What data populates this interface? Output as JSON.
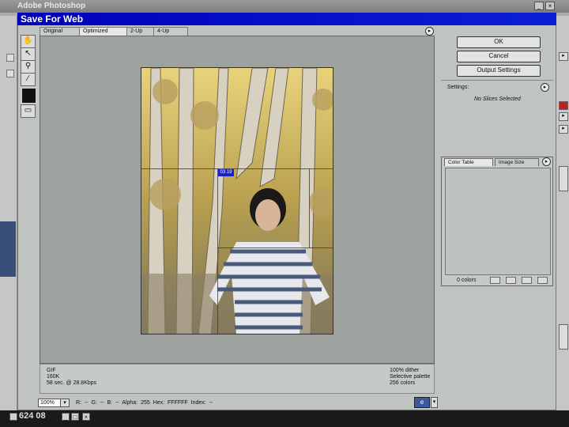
{
  "app": {
    "title": "Adobe Photoshop",
    "taskbar_title": "624 08"
  },
  "dialog": {
    "title": "Save For Web"
  },
  "tabs": [
    "Original",
    "Optimized",
    "2-Up",
    "4-Up"
  ],
  "tools": [
    "hand-tool",
    "slice-select-tool",
    "zoom-tool",
    "eyedropper-tool",
    "eyedropper-color",
    "toggle-slices-visibility"
  ],
  "preview": {
    "slice_badge": "03 19"
  },
  "info": {
    "left": [
      "GIF",
      "160K",
      "58 sec. @ 28.8Kbps"
    ],
    "right": [
      "100% dither",
      "Selective palette",
      "256 colors"
    ]
  },
  "status": {
    "zoom": "100%",
    "readout": "R: -- G: --  B: --  Alpha: 255  Hex: FFFFFF  Index: --"
  },
  "buttons": {
    "ok": "OK",
    "cancel": "Cancel",
    "output_settings": "Output Settings"
  },
  "settings": {
    "label": "Settings:",
    "no_slices": "No Slices Selected"
  },
  "color_table": {
    "tabs": [
      "Color Table",
      "Image Size"
    ],
    "count": "0 colors"
  }
}
